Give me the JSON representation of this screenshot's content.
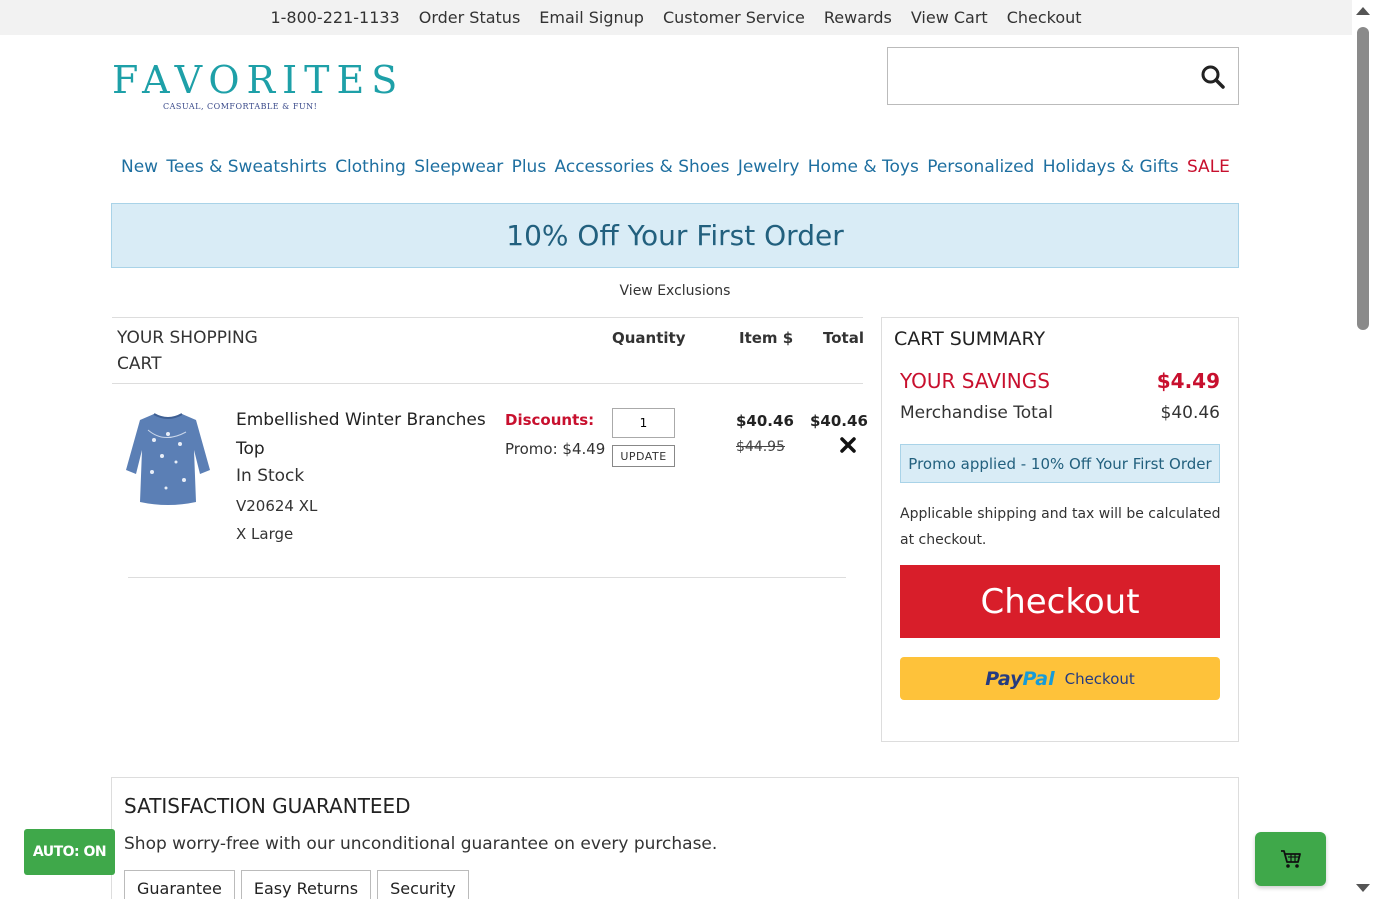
{
  "utility": {
    "phone": "1-800-221-1133",
    "order_status": "Order Status",
    "email_signup": "Email Signup",
    "customer_service": "Customer Service",
    "rewards": "Rewards",
    "view_cart": "View Cart",
    "checkout": "Checkout"
  },
  "logo": {
    "wordmark": "FAVORITES",
    "tagline": "CASUAL, COMFORTABLE & FUN!"
  },
  "search": {
    "placeholder": "",
    "value": ""
  },
  "nav": {
    "new": "New",
    "tees": "Tees & Sweatshirts",
    "clothing": "Clothing",
    "sleepwear": "Sleepwear",
    "plus": "Plus",
    "accessories": "Accessories & Shoes",
    "jewelry": "Jewelry",
    "home": "Home & Toys",
    "personalized": "Personalized",
    "holidays": "Holidays & Gifts",
    "sale": "SALE"
  },
  "banner": {
    "text": "10% Off Your First Order",
    "exclusions": "View Exclusions"
  },
  "cart": {
    "title": "YOUR SHOPPING CART",
    "col_quantity": "Quantity",
    "col_item_price": "Item $",
    "col_total": "Total",
    "items": [
      {
        "name": "Embellished Winter Branches Top",
        "stock": "In Stock",
        "sku": "V20624 XL",
        "size": "X Large",
        "discounts_label": "Discounts:",
        "promo": "Promo: $4.49",
        "quantity": "1",
        "update_label": "UPDATE",
        "price": "$40.46",
        "original_price": "$44.95",
        "total": "$40.46"
      }
    ]
  },
  "summary": {
    "title": "CART SUMMARY",
    "savings_label": "YOUR SAVINGS",
    "savings_value": "$4.49",
    "merch_label": "Merchandise Total",
    "merch_value": "$40.46",
    "promo_applied": "Promo applied - 10% Off Your First Order",
    "shipping_note": "Applicable shipping and tax will be calculated at checkout.",
    "checkout_label": "Checkout",
    "paypal_pay": "Pay",
    "paypal_pal": "Pal",
    "paypal_checkout": "Checkout"
  },
  "satisfaction": {
    "title": "SATISFACTION GUARANTEED",
    "text": "Shop worry-free with our unconditional guarantee on every purchase.",
    "tabs": [
      "Guarantee",
      "Easy Returns",
      "Security"
    ]
  },
  "auto_badge": "AUTO: ON",
  "colors": {
    "brand_teal": "#1ea0a8",
    "nav_blue": "#1e6fa0",
    "sale_red": "#c8102e",
    "checkout_red": "#d81e2a",
    "paypal_yellow": "#fec23a",
    "promo_bg": "#d9ecf6",
    "fab_green": "#3fa84a"
  },
  "icons": [
    "search-icon",
    "remove-icon",
    "cart-icon",
    "product-image"
  ]
}
